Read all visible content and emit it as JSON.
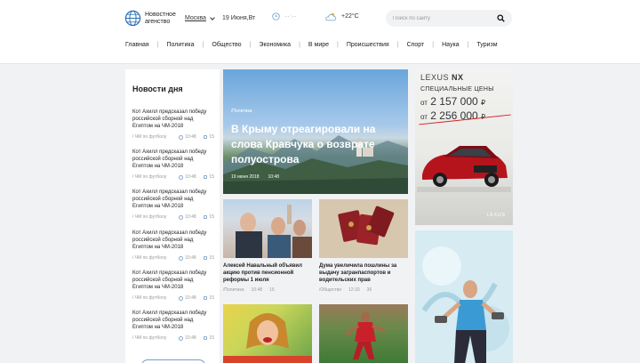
{
  "header": {
    "logo_text": "Новостное агенство",
    "city": "Москва",
    "date": "19 Июня,Вт",
    "time": "--:--",
    "temperature": "+22°C",
    "search_placeholder": "Поиск по сайту"
  },
  "nav": {
    "items": [
      "Главная",
      "Политика",
      "Общество",
      "Экономика",
      "В мире",
      "Происшествия",
      "Спорт",
      "Наука",
      "Туризм"
    ]
  },
  "sidebar": {
    "title": "Новости дня",
    "items": [
      {
        "title": "Кот Ахилл предсказал победу российской сборной над Египтом на ЧМ-2018",
        "category": "/ ЧМ по футболу",
        "time": "10:48",
        "comments": "15"
      },
      {
        "title": "Кот Ахилл предсказал победу российской сборной над Египтом на ЧМ-2018",
        "category": "/ ЧМ по футболу",
        "time": "10:48",
        "comments": "15"
      },
      {
        "title": "Кот Ахилл предсказал победу российской сборной над Египтом на ЧМ-2018",
        "category": "/ ЧМ по футболу",
        "time": "10:48",
        "comments": "15"
      },
      {
        "title": "Кот Ахилл предсказал победу российской сборной над Египтом на ЧМ-2018",
        "category": "/ ЧМ по футболу",
        "time": "10:48",
        "comments": "15"
      },
      {
        "title": "Кот Ахилл предсказал победу российской сборной над Египтом на ЧМ-2018",
        "category": "/ ЧМ по футболу",
        "time": "10:48",
        "comments": "15"
      },
      {
        "title": "Кот Ахилл предсказал победу российской сборной над Египтом на ЧМ-2018",
        "category": "/ ЧМ по футболу",
        "time": "10:48",
        "comments": "15"
      }
    ]
  },
  "hero": {
    "category": "/Политика",
    "title": "В Крыму отреагировали на слова Кравчука о возврате полуострова",
    "date": "19 июня 2018",
    "time": "10:48"
  },
  "cards": [
    {
      "title": "Алексей Навальный объявил акцию против пенсионной реформы 1 июля",
      "category": "/Политика",
      "time": "10:48",
      "comments": "15"
    },
    {
      "title": "Дума увеличила пошлины за выдачу загранпаспортов и водительских прав",
      "category": "/Общество",
      "time": "12:33",
      "comments": "36"
    }
  ],
  "ad": {
    "brand": "LEXUS",
    "model": "NX",
    "subtitle": "СПЕЦИАЛЬНЫЕ ЦЕНЫ",
    "price_prefix": "от",
    "price_new": "2 157 000",
    "price_old": "2 256 000",
    "currency": "₽",
    "logo": "LEXUS"
  },
  "colors": {
    "accent": "#2a6fb5",
    "meta_icon": "#8aa9cf",
    "strike": "#d21f1f"
  }
}
